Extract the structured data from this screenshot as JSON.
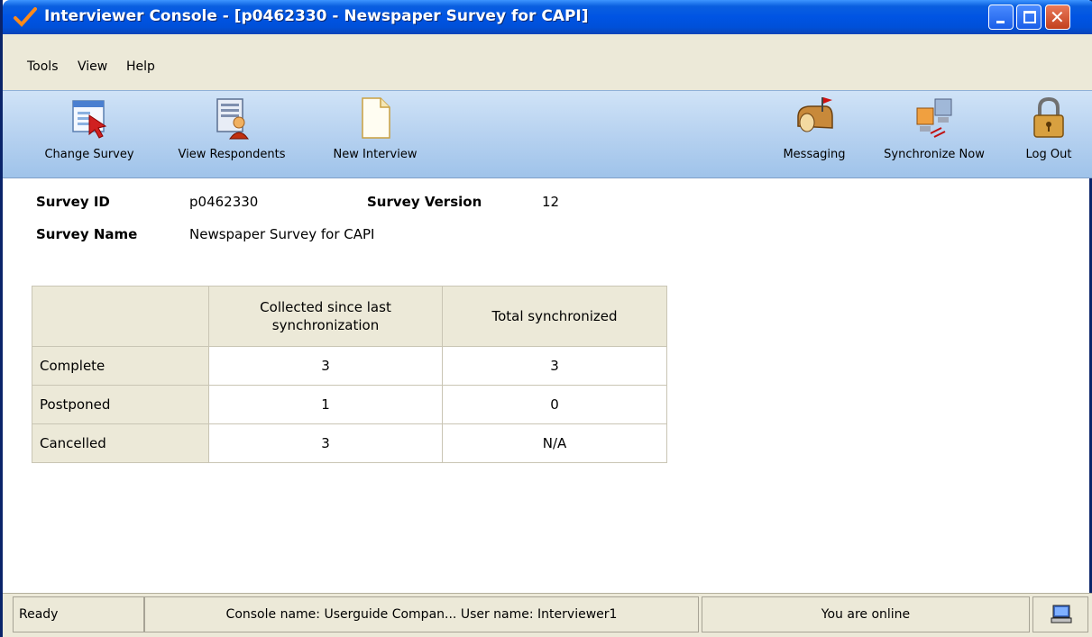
{
  "window": {
    "title": "Interviewer Console - [p0462330 - Newspaper Survey for CAPI]",
    "title_bar_color": "#0054e3"
  },
  "menu": {
    "items": [
      "Tools",
      "View",
      "Help"
    ]
  },
  "toolbar": {
    "change_survey": "Change Survey",
    "view_respondents": "View Respondents",
    "new_interview": "New Interview",
    "messaging": "Messaging",
    "synchronize_now": "Synchronize Now",
    "log_out": "Log Out"
  },
  "survey": {
    "id_label": "Survey ID",
    "id_value": "p0462330",
    "version_label": "Survey Version",
    "version_value": "12",
    "name_label": "Survey Name",
    "name_value": "Newspaper Survey for CAPI"
  },
  "stats_table": {
    "headers": [
      "",
      "Collected since last synchronization",
      "Total synchronized"
    ],
    "rows": [
      {
        "label": "Complete",
        "collected": "3",
        "total": "3"
      },
      {
        "label": "Postponed",
        "collected": "1",
        "total": "0"
      },
      {
        "label": "Cancelled",
        "collected": "3",
        "total": "N/A"
      }
    ]
  },
  "status_bar": {
    "state": "Ready",
    "console": "Console name:  Userguide Compan...   User name: Interviewer1",
    "online": "You are online"
  }
}
